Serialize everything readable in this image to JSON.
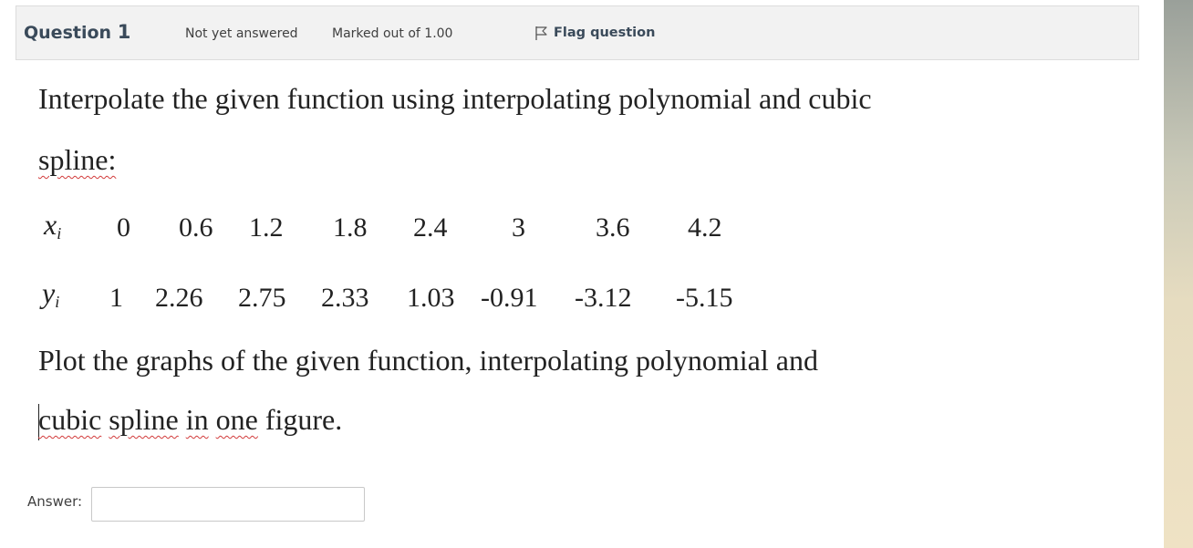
{
  "question_info": {
    "title_prefix": "Question",
    "number": "1",
    "state": "Not yet answered",
    "grade": "Marked out of 1.00",
    "flag_label": "Flag question",
    "flag_icon": "flag-outline-icon"
  },
  "question": {
    "line1": "Interpolate the given function using interpolating polynomial and cubic",
    "line2": "spline:",
    "table": {
      "x_label": "x",
      "x_sub": "i",
      "y_label": "y",
      "y_sub": "i",
      "x_values": [
        "0",
        "0.6",
        "1.2",
        "1.8",
        "2.4",
        "3",
        "3.6",
        "4.2"
      ],
      "y_values": [
        "1",
        "2.26",
        "2.75",
        "2.33",
        "1.03",
        "-0.91",
        "-3.12",
        "-5.15"
      ]
    },
    "line3": "Plot the graphs of the given function, interpolating polynomial and",
    "line4_words": [
      "cubic",
      "spline",
      "in",
      "one",
      "figure."
    ]
  },
  "answer": {
    "label": "Answer:",
    "value": "",
    "placeholder": ""
  }
}
